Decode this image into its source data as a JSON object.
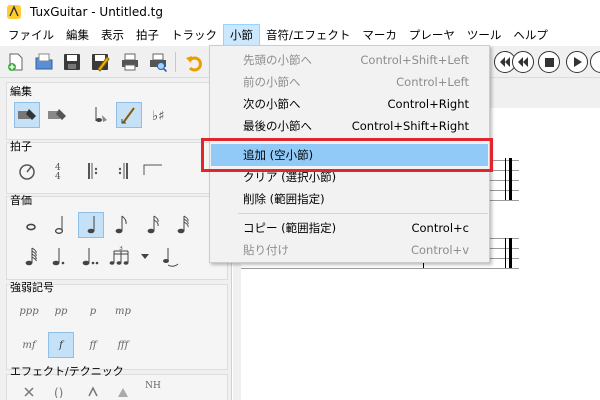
{
  "window": {
    "title": "TuxGuitar - Untitled.tg"
  },
  "menubar": {
    "items": [
      "ファイル",
      "編集",
      "表示",
      "拍子",
      "トラック",
      "小節",
      "音符/エフェクト",
      "マーカ",
      "プレーヤ",
      "ツール",
      "ヘルプ"
    ],
    "active_index": 5
  },
  "measure_menu": {
    "items": [
      {
        "label": "先頭の小節へ",
        "shortcut": "Control+Shift+Left",
        "enabled": false
      },
      {
        "label": "前の小節へ",
        "shortcut": "Control+Left",
        "enabled": false
      },
      {
        "label": "次の小節へ",
        "shortcut": "Control+Right",
        "enabled": true
      },
      {
        "label": "最後の小節へ",
        "shortcut": "Control+Shift+Right",
        "enabled": true
      },
      {
        "label": "追加 (空小節)",
        "shortcut": "",
        "enabled": true,
        "highlighted": true
      },
      {
        "label": "クリア (選択小節)",
        "shortcut": "",
        "enabled": true
      },
      {
        "label": "削除 (範囲指定)",
        "shortcut": "",
        "enabled": true
      },
      {
        "label": "コピー (範囲指定)",
        "shortcut": "Control+c",
        "enabled": true
      },
      {
        "label": "貼り付け",
        "shortcut": "Control+v",
        "enabled": false
      }
    ]
  },
  "sidebar": {
    "sections": [
      "編集",
      "拍子",
      "音価",
      "強弱記号",
      "エフェクト/テクニック"
    ],
    "dynamics": [
      "ppp",
      "pp",
      "p",
      "mp",
      "mf",
      "f",
      "ff",
      "fff"
    ],
    "tuplet_label": "3",
    "effect_labels": [
      "NH"
    ]
  },
  "colors": {
    "accent": "#91c9f7",
    "annotation": "#e0262d"
  },
  "icons": {
    "app": "tuxguitar-logo-icon",
    "toolbar": [
      "new-file-icon",
      "open-file-icon",
      "save-icon",
      "save-as-icon",
      "print-icon",
      "print-preview-icon",
      "undo-icon"
    ],
    "transport": [
      "rewind-icon",
      "stop-icon",
      "play-icon"
    ]
  }
}
